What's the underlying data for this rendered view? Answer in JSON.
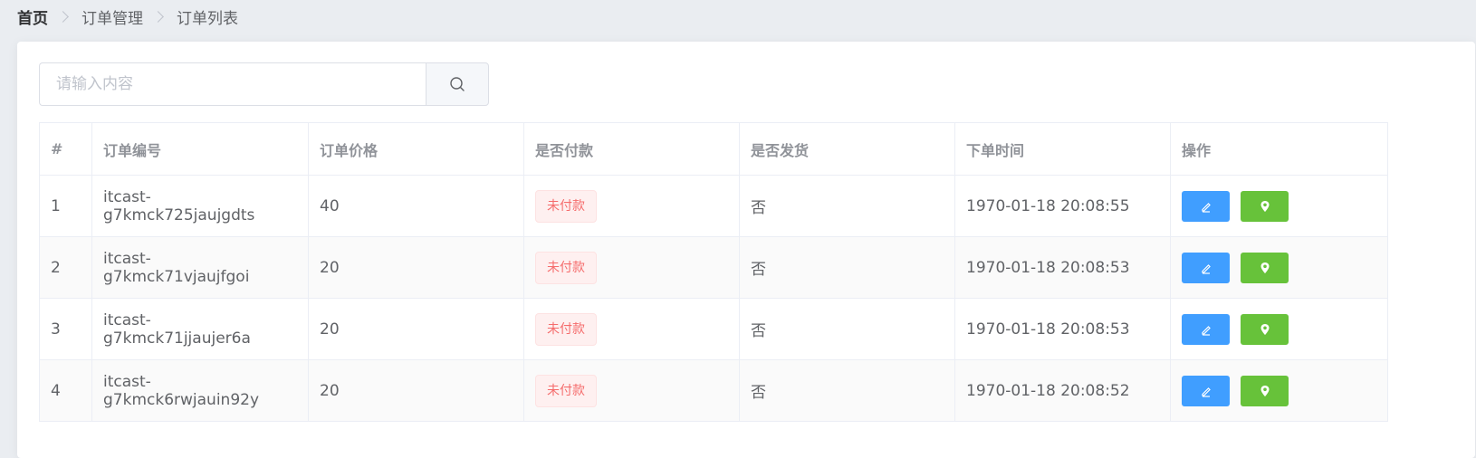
{
  "breadcrumb": {
    "home": "首页",
    "level1": "订单管理",
    "level2": "订单列表"
  },
  "search": {
    "placeholder": "请输入内容",
    "value": "",
    "icon": "search-icon"
  },
  "table": {
    "columns": [
      "#",
      "订单编号",
      "订单价格",
      "是否付款",
      "是否发货",
      "下单时间",
      "操作"
    ],
    "rows": [
      {
        "index": "1",
        "order_no": "itcast-g7kmck725jaujgdts",
        "price": "40",
        "paid": "未付款",
        "shipped": "否",
        "time": "1970-01-18 20:08:55"
      },
      {
        "index": "2",
        "order_no": "itcast-g7kmck71vjaujfgoi",
        "price": "20",
        "paid": "未付款",
        "shipped": "否",
        "time": "1970-01-18 20:08:53"
      },
      {
        "index": "3",
        "order_no": "itcast-g7kmck71jjaujer6a",
        "price": "20",
        "paid": "未付款",
        "shipped": "否",
        "time": "1970-01-18 20:08:53"
      },
      {
        "index": "4",
        "order_no": "itcast-g7kmck6rwjauin92y",
        "price": "20",
        "paid": "未付款",
        "shipped": "否",
        "time": "1970-01-18 20:08:52"
      }
    ],
    "action_icons": [
      "edit-icon",
      "location-icon"
    ]
  },
  "colors": {
    "primary": "#409eff",
    "success": "#67c23a",
    "danger": "#f56c6c",
    "background": "#eaedf1"
  }
}
